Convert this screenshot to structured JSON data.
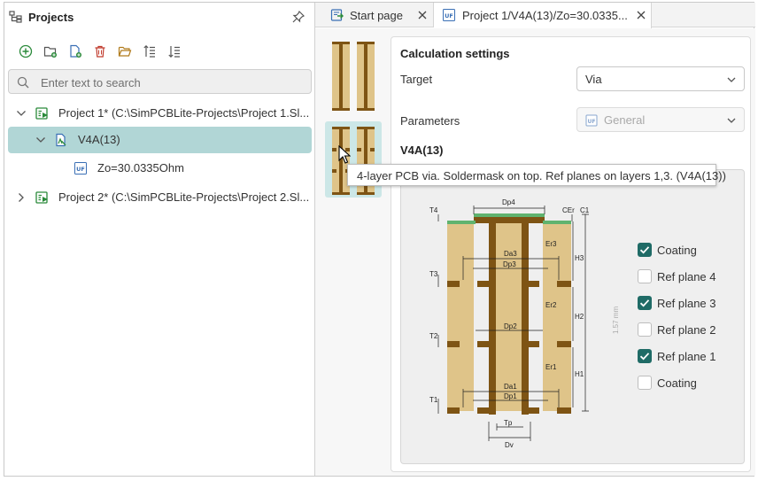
{
  "projects_panel": {
    "title": "Projects",
    "toolbar": [
      "add-icon",
      "new-folder-icon",
      "new-file-icon",
      "delete-icon",
      "open-folder-icon",
      "sort-ascending-icon",
      "sort-descending-icon"
    ],
    "search": {
      "placeholder": "Enter text to search",
      "value": ""
    },
    "tree": [
      {
        "label": "Project 1* (C:\\SimPCBLite-Projects\\Project 1.Sl...",
        "expanded": true
      },
      {
        "label": "V4A(13)",
        "expanded": true,
        "selected": true
      },
      {
        "label": "Zo=30.0335Ohm"
      },
      {
        "label": "Project 2* (C:\\SimPCBLite-Projects\\Project 2.Sl...",
        "expanded": false
      }
    ]
  },
  "tabs": [
    {
      "label": "Start page",
      "icon": "start-page-icon"
    },
    {
      "label": "Project 1/V4A(13)/Zo=30.0335...",
      "icon": "uf-icon",
      "active": true
    }
  ],
  "settings": {
    "section_title": "Calculation settings",
    "target_label": "Target",
    "target_value": "Via",
    "parameters_label": "Parameters",
    "parameters_value": "General",
    "structure_title": "V4A(13)"
  },
  "tooltip": "4-layer PCB via. Soldermask on top. Ref planes on layers 1,3. (V4A(13))",
  "checkboxes": [
    {
      "label": "Coating",
      "checked": true
    },
    {
      "label": "Ref plane 4",
      "checked": false
    },
    {
      "label": "Ref plane 3",
      "checked": true
    },
    {
      "label": "Ref plane 2",
      "checked": false
    },
    {
      "label": "Ref plane 1",
      "checked": true
    },
    {
      "label": "Coating",
      "checked": false
    }
  ],
  "diagram": {
    "labels": {
      "dp4": "Dp4",
      "cer": "CEr",
      "c1": "C1",
      "t4": "T4",
      "er3": "Er3",
      "h3": "H3",
      "da3": "Da3",
      "dp3": "Dp3",
      "t3": "T3",
      "er2": "Er2",
      "h2": "H2",
      "thickness": "1.57 mm",
      "dp2": "Dp2",
      "t2": "T2",
      "er1": "Er1",
      "h1": "H1",
      "da1": "Da1",
      "dp1": "Dp1",
      "t1": "T1",
      "tp": "Tp",
      "dv": "Dv"
    },
    "colors": {
      "dielectric": "#dfc489",
      "copper": "#7e5414",
      "soldermask": "#5fb36f"
    }
  }
}
